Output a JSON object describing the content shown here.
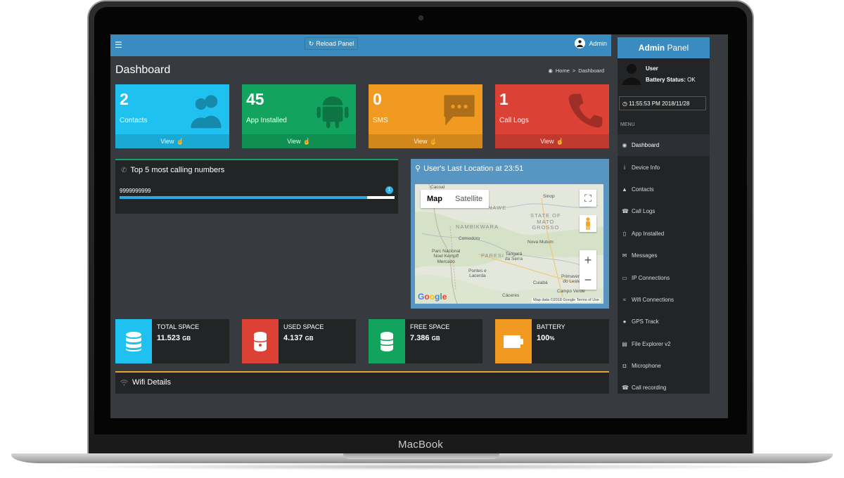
{
  "device": {
    "brand": "MacBook"
  },
  "topbar": {
    "reload_label": "Reload Panel",
    "user_label": "Admin"
  },
  "page": {
    "title": "Dashboard",
    "breadcrumb": [
      "Home",
      "Dashboard"
    ]
  },
  "stats": [
    {
      "value": "2",
      "label": "Contacts",
      "footer": "View",
      "color": "#1ec1ef",
      "icon": "users-icon"
    },
    {
      "value": "45",
      "label": "App Installed",
      "footer": "View",
      "color": "#12a45e",
      "icon": "android-icon"
    },
    {
      "value": "0",
      "label": "SMS",
      "footer": "View",
      "color": "#f09a22",
      "icon": "sms-icon"
    },
    {
      "value": "1",
      "label": "Call Logs",
      "footer": "View",
      "color": "#dc4135",
      "icon": "phone-icon"
    }
  ],
  "calls": {
    "title": "Top 5 most calling numbers",
    "items": [
      {
        "number": "9999999999",
        "badge": "1",
        "progress": 0.9
      }
    ]
  },
  "location": {
    "title": "User's Last Location at 23:51",
    "map_tabs": [
      "Map",
      "Satellite"
    ],
    "labels": {
      "cacoal": "Cacoal",
      "sinop": "Sinop",
      "nawe": "NAWE",
      "nambikwara": "NAMBIKWARA",
      "state": "STATE OF\nMATO\nGROSSO",
      "comodoro": "Comodoro",
      "nova": "Nova Mutum",
      "pareci": "PARESI",
      "tangara": "Tangará\nda Serra",
      "parque": "Parc Nacional\nNoel Kempff\nMercado",
      "pontes": "Pontes e\nLacerda",
      "cuiaba": "Cuiabá",
      "primavera": "Primavera\ndo Leste",
      "campo": "Campo Verde",
      "caceres": "Cáceres"
    },
    "google": "Google",
    "attribution": "Map data ©2018 Google   Terms of Use"
  },
  "info_boxes": [
    {
      "label": "TOTAL SPACE",
      "value": "11.523",
      "unit": "GB",
      "color": "#1ec1ef",
      "icon": "database-icon"
    },
    {
      "label": "USED SPACE",
      "value": "4.137",
      "unit": "GB",
      "color": "#dc4135",
      "icon": "database-icon"
    },
    {
      "label": "FREE SPACE",
      "value": "7.386",
      "unit": "GB",
      "color": "#12a45e",
      "icon": "database-icon"
    },
    {
      "label": "BATTERY",
      "value": "100",
      "unit": "%",
      "color": "#f09a22",
      "icon": "battery-icon"
    }
  ],
  "wifi": {
    "title": "Wifi Details"
  },
  "sidebar": {
    "title_bold": "Admin",
    "title_rest": "Panel",
    "user_name": "User",
    "battery_label": "Battery Status:",
    "battery_value": "OK",
    "clock": "11:55:53 PM 2018/11/28",
    "menu_header": "MENU",
    "items": [
      {
        "label": "Dashboard",
        "icon": "dashboard-icon",
        "active": true
      },
      {
        "label": "Device Info",
        "icon": "info-icon"
      },
      {
        "label": "Contacts",
        "icon": "user-icon"
      },
      {
        "label": "Call Logs",
        "icon": "phone-icon"
      },
      {
        "label": "App Installed",
        "icon": "mobile-icon"
      },
      {
        "label": "Messages",
        "icon": "envelope-icon"
      },
      {
        "label": "IP Connections",
        "icon": "monitor-icon"
      },
      {
        "label": "Wifi Connections",
        "icon": "wifi-icon"
      },
      {
        "label": "GPS Track",
        "icon": "pin-icon"
      },
      {
        "label": "File Explorer v2",
        "icon": "file-icon"
      },
      {
        "label": "Microphone",
        "icon": "mic-icon"
      },
      {
        "label": "Call recording",
        "icon": "phone-icon"
      }
    ]
  }
}
